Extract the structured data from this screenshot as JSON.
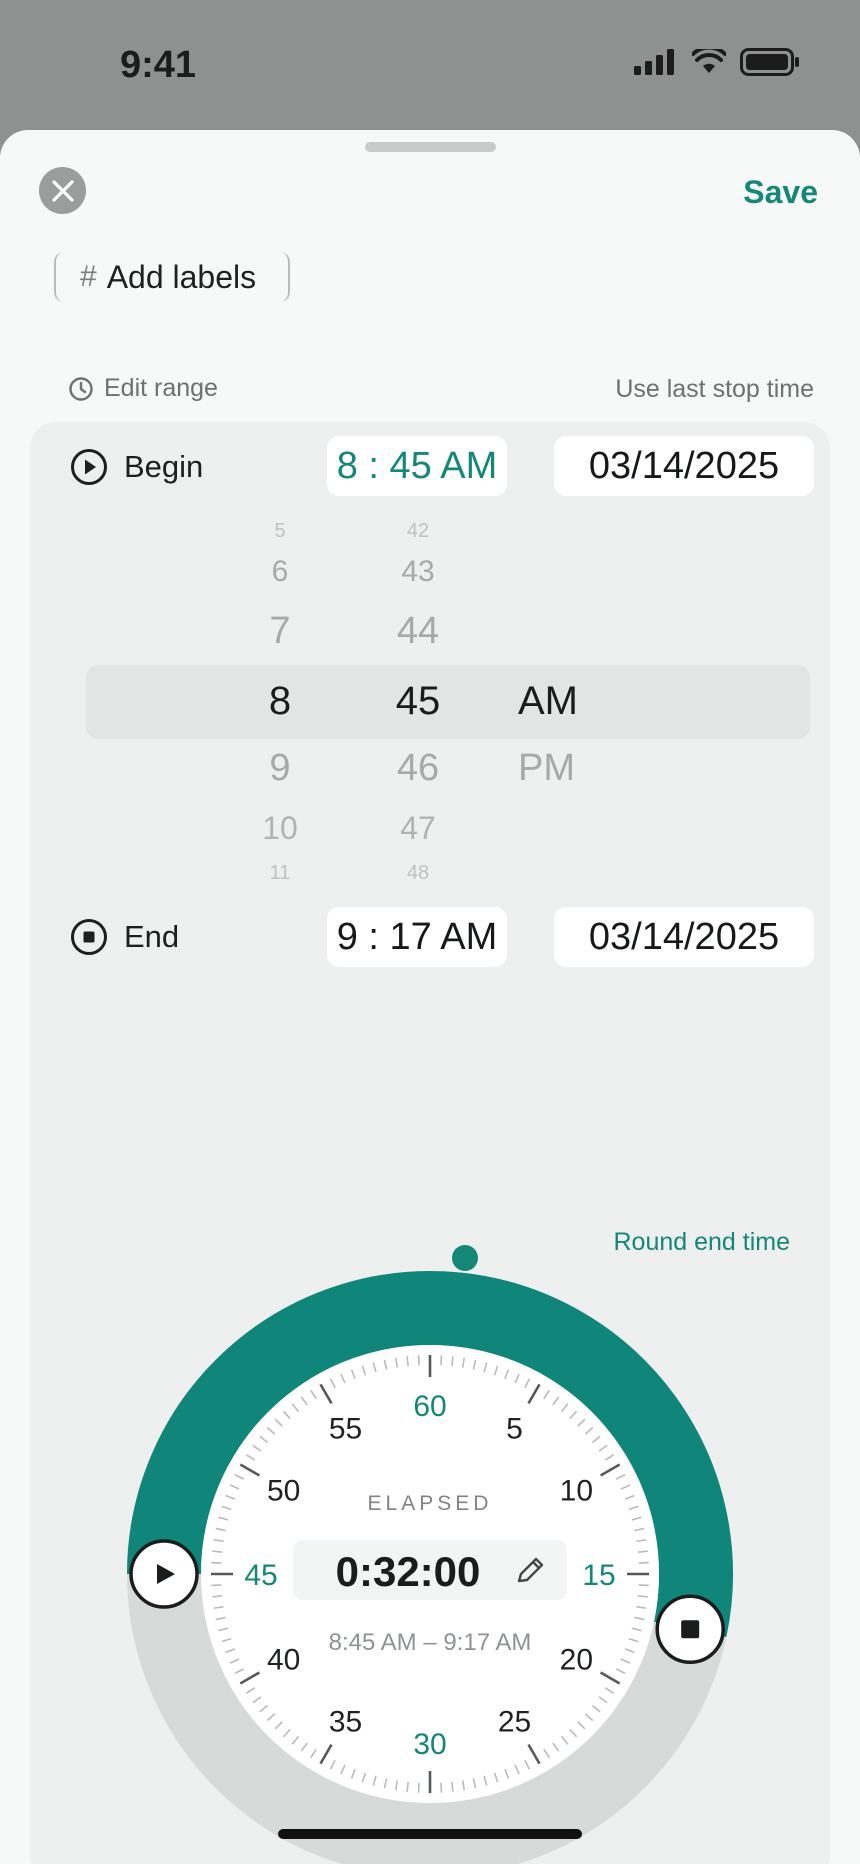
{
  "status_bar": {
    "time": "9:41"
  },
  "header": {
    "save_label": "Save"
  },
  "labels": {
    "hash": "#",
    "text": "Add labels"
  },
  "range": {
    "edit_label": "Edit range",
    "use_last_label": "Use last stop time"
  },
  "begin": {
    "label": "Begin",
    "time": "8 : 45 AM",
    "date": "03/14/2025",
    "picker": {
      "hours": [
        "5",
        "6",
        "7",
        "8",
        "9",
        "10",
        "11"
      ],
      "minutes": [
        "42",
        "43",
        "44",
        "45",
        "46",
        "47",
        "48"
      ],
      "periods": [
        "AM",
        "PM"
      ],
      "selected_hour": "8",
      "selected_minute": "45",
      "selected_period": "AM"
    }
  },
  "end": {
    "label": "End",
    "time": "9 : 17 AM",
    "date": "03/14/2025",
    "round_label": "Round end time"
  },
  "dial": {
    "elapsed_label": "ELAPSED",
    "elapsed_value": "0:32:00",
    "range_text": "8:45 AM – 9:17 AM",
    "minute_labels": [
      "60",
      "5",
      "10",
      "15",
      "20",
      "25",
      "30",
      "35",
      "40",
      "45",
      "50",
      "55"
    ],
    "start_minute": 45,
    "end_minute": 17
  },
  "colors": {
    "accent": "#148777",
    "track": "#d6dad9",
    "arc": "#10867a"
  }
}
